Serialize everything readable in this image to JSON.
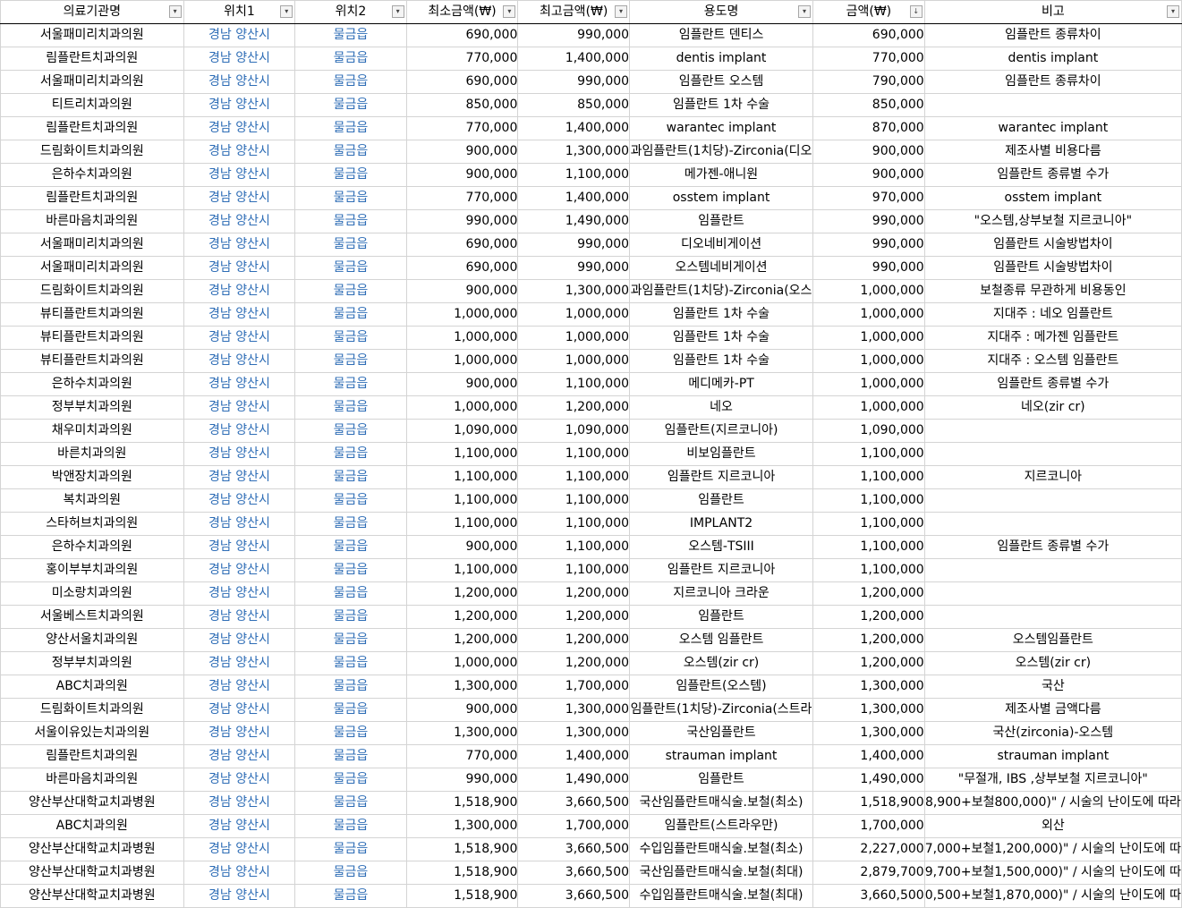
{
  "colors": {
    "location_text": "#2e6db6",
    "gridline": "#d4d4d4",
    "header_rule": "#000000"
  },
  "icons": {
    "filter": "filter-dropdown-icon",
    "sort": "sort-ascending-filter-icon"
  },
  "columns": [
    {
      "label": "의료기관명",
      "icon": "▾"
    },
    {
      "label": "위치1",
      "icon": "▾"
    },
    {
      "label": "위치2",
      "icon": "▾"
    },
    {
      "label": "최소금액(₩)",
      "icon": "▾"
    },
    {
      "label": "최고금액(₩)",
      "icon": "▾"
    },
    {
      "label": "용도명",
      "icon": "▾"
    },
    {
      "label": "금액(₩)",
      "icon": "↓"
    },
    {
      "label": "비고",
      "icon": "▾"
    }
  ],
  "rows": [
    [
      "서울패미리치과의원",
      "경남 양산시",
      "물금읍",
      "690,000",
      "990,000",
      "임플란트 덴티스",
      "690,000",
      "임플란트 종류차이"
    ],
    [
      "림플란트치과의원",
      "경남 양산시",
      "물금읍",
      "770,000",
      "1,400,000",
      "dentis implant",
      "770,000",
      "dentis implant"
    ],
    [
      "서울패미리치과의원",
      "경남 양산시",
      "물금읍",
      "690,000",
      "990,000",
      "임플란트 오스템",
      "790,000",
      "임플란트 종류차이"
    ],
    [
      "티트리치과의원",
      "경남 양산시",
      "물금읍",
      "850,000",
      "850,000",
      "임플란트 1차 수술",
      "850,000",
      ""
    ],
    [
      "림플란트치과의원",
      "경남 양산시",
      "물금읍",
      "770,000",
      "1,400,000",
      "warantec implant",
      "870,000",
      "warantec implant"
    ],
    [
      "드림화이트치과의원",
      "경남 양산시",
      "물금읍",
      "900,000",
      "1,300,000",
      "과임플란트(1치당)-Zirconia(디오",
      "900,000",
      "제조사별 비용다름"
    ],
    [
      "은하수치과의원",
      "경남 양산시",
      "물금읍",
      "900,000",
      "1,100,000",
      "메가젠-애니원",
      "900,000",
      "임플란트 종류별 수가"
    ],
    [
      "림플란트치과의원",
      "경남 양산시",
      "물금읍",
      "770,000",
      "1,400,000",
      "osstem implant",
      "970,000",
      "osstem implant"
    ],
    [
      "바른마음치과의원",
      "경남 양산시",
      "물금읍",
      "990,000",
      "1,490,000",
      "임플란트",
      "990,000",
      "\"오스템,상부보철 지르코니아\""
    ],
    [
      "서울패미리치과의원",
      "경남 양산시",
      "물금읍",
      "690,000",
      "990,000",
      "디오네비게이션",
      "990,000",
      "임플란트 시술방법차이"
    ],
    [
      "서울패미리치과의원",
      "경남 양산시",
      "물금읍",
      "690,000",
      "990,000",
      "오스템네비게이션",
      "990,000",
      "임플란트 시술방법차이"
    ],
    [
      "드림화이트치과의원",
      "경남 양산시",
      "물금읍",
      "900,000",
      "1,300,000",
      "과임플란트(1치당)-Zirconia(오스",
      "1,000,000",
      "보철종류 무관하게 비용동인"
    ],
    [
      "뷰티플란트치과의원",
      "경남 양산시",
      "물금읍",
      "1,000,000",
      "1,000,000",
      "임플란트 1차 수술",
      "1,000,000",
      "지대주 : 네오 임플란트"
    ],
    [
      "뷰티플란트치과의원",
      "경남 양산시",
      "물금읍",
      "1,000,000",
      "1,000,000",
      "임플란트 1차 수술",
      "1,000,000",
      "지대주 : 메가젠 임플란트"
    ],
    [
      "뷰티플란트치과의원",
      "경남 양산시",
      "물금읍",
      "1,000,000",
      "1,000,000",
      "임플란트 1차 수술",
      "1,000,000",
      "지대주 : 오스템 임플란트"
    ],
    [
      "은하수치과의원",
      "경남 양산시",
      "물금읍",
      "900,000",
      "1,100,000",
      "메디메카-PT",
      "1,000,000",
      "임플란트 종류별 수가"
    ],
    [
      "정부부치과의원",
      "경남 양산시",
      "물금읍",
      "1,000,000",
      "1,200,000",
      "네오",
      "1,000,000",
      "네오(zir cr)"
    ],
    [
      "채우미치과의원",
      "경남 양산시",
      "물금읍",
      "1,090,000",
      "1,090,000",
      "임플란트(지르코니아)",
      "1,090,000",
      ""
    ],
    [
      "바른치과의원",
      "경남 양산시",
      "물금읍",
      "1,100,000",
      "1,100,000",
      "비보임플란트",
      "1,100,000",
      ""
    ],
    [
      "박앤장치과의원",
      "경남 양산시",
      "물금읍",
      "1,100,000",
      "1,100,000",
      "임플란트 지르코니아",
      "1,100,000",
      "지르코니아"
    ],
    [
      "복치과의원",
      "경남 양산시",
      "물금읍",
      "1,100,000",
      "1,100,000",
      "임플란트",
      "1,100,000",
      ""
    ],
    [
      "스타허브치과의원",
      "경남 양산시",
      "물금읍",
      "1,100,000",
      "1,100,000",
      "IMPLANT2",
      "1,100,000",
      ""
    ],
    [
      "은하수치과의원",
      "경남 양산시",
      "물금읍",
      "900,000",
      "1,100,000",
      "오스템-TSIII",
      "1,100,000",
      "임플란트 종류별 수가"
    ],
    [
      "홍이부부치과의원",
      "경남 양산시",
      "물금읍",
      "1,100,000",
      "1,100,000",
      "임플란트 지르코니아",
      "1,100,000",
      ""
    ],
    [
      "미소랑치과의원",
      "경남 양산시",
      "물금읍",
      "1,200,000",
      "1,200,000",
      "지르코니아 크라운",
      "1,200,000",
      ""
    ],
    [
      "서울베스트치과의원",
      "경남 양산시",
      "물금읍",
      "1,200,000",
      "1,200,000",
      "임플란트",
      "1,200,000",
      ""
    ],
    [
      "양산서울치과의원",
      "경남 양산시",
      "물금읍",
      "1,200,000",
      "1,200,000",
      "오스템 임플란트",
      "1,200,000",
      "오스템임플란트"
    ],
    [
      "정부부치과의원",
      "경남 양산시",
      "물금읍",
      "1,000,000",
      "1,200,000",
      "오스템(zir cr)",
      "1,200,000",
      "오스템(zir cr)"
    ],
    [
      "ABC치과의원",
      "경남 양산시",
      "물금읍",
      "1,300,000",
      "1,700,000",
      "임플란트(오스템)",
      "1,300,000",
      "국산"
    ],
    [
      "드림화이트치과의원",
      "경남 양산시",
      "물금읍",
      "900,000",
      "1,300,000",
      "임플란트(1치당)-Zirconia(스트라",
      "1,300,000",
      "제조사별 금액다름"
    ],
    [
      "서울이유있는치과의원",
      "경남 양산시",
      "물금읍",
      "1,300,000",
      "1,300,000",
      "국산임플란트",
      "1,300,000",
      "국산(zirconia)-오스템"
    ],
    [
      "림플란트치과의원",
      "경남 양산시",
      "물금읍",
      "770,000",
      "1,400,000",
      "strauman implant",
      "1,400,000",
      "strauman implant"
    ],
    [
      "바른마음치과의원",
      "경남 양산시",
      "물금읍",
      "990,000",
      "1,490,000",
      "임플란트",
      "1,490,000",
      "\"무절개, IBS ,상부보철 지르코니아\""
    ],
    [
      "양산부산대학교치과병원",
      "경남 양산시",
      "물금읍",
      "1,518,900",
      "3,660,500",
      "국산임플란트매식술.보철(최소)",
      "1,518,900",
      "8,900+보철800,000)\" / 시술의 난이도에 따라"
    ],
    [
      "ABC치과의원",
      "경남 양산시",
      "물금읍",
      "1,300,000",
      "1,700,000",
      "임플란트(스트라우만)",
      "1,700,000",
      "외산"
    ],
    [
      "양산부산대학교치과병원",
      "경남 양산시",
      "물금읍",
      "1,518,900",
      "3,660,500",
      "수입임플란트매식술.보철(최소)",
      "2,227,000",
      "7,000+보철1,200,000)\" / 시술의 난이도에 따"
    ],
    [
      "양산부산대학교치과병원",
      "경남 양산시",
      "물금읍",
      "1,518,900",
      "3,660,500",
      "국산임플란트매식술.보철(최대)",
      "2,879,700",
      "9,700+보철1,500,000)\" / 시술의 난이도에 따"
    ],
    [
      "양산부산대학교치과병원",
      "경남 양산시",
      "물금읍",
      "1,518,900",
      "3,660,500",
      "수입임플란트매식술.보철(최대)",
      "3,660,500",
      "0,500+보철1,870,000)\" / 시술의 난이도에 따"
    ]
  ]
}
